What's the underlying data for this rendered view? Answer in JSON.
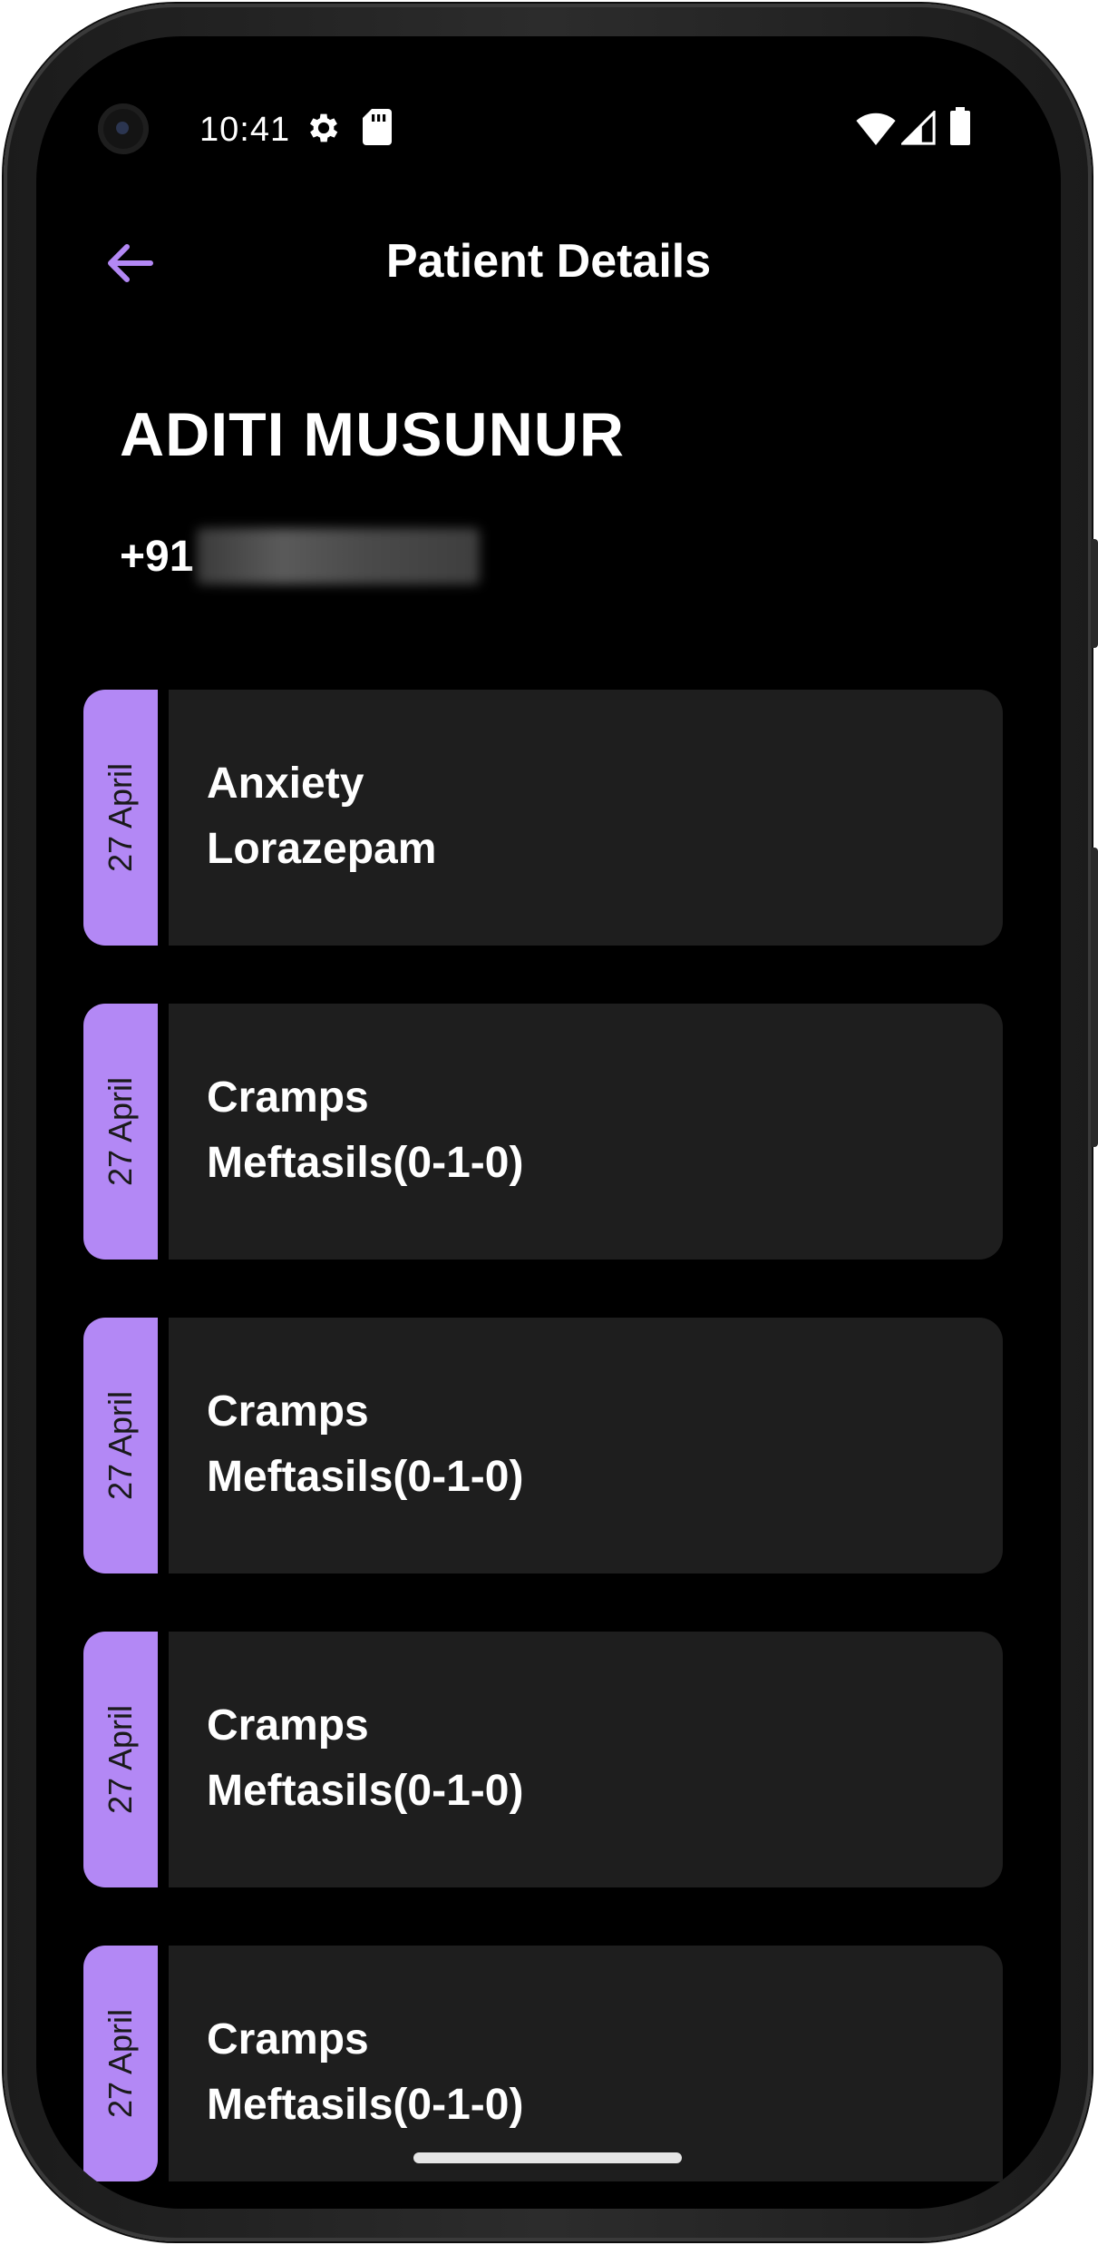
{
  "status_bar": {
    "time": "10:41",
    "icons": [
      "gear-icon",
      "sd-card-icon",
      "wifi-icon",
      "signal-icon",
      "battery-icon"
    ]
  },
  "app_bar": {
    "title": "Patient Details",
    "back_icon": "arrow-left-icon"
  },
  "patient": {
    "name": "ADITI MUSUNUR",
    "phone_prefix": "+91"
  },
  "colors": {
    "accent": "#b388f5",
    "background": "#000000",
    "card": "#1e1e1e"
  },
  "records": [
    {
      "date": "27 April",
      "condition": "Anxiety",
      "medicine": "Lorazepam"
    },
    {
      "date": "27 April",
      "condition": "Cramps",
      "medicine": "Meftasils(0-1-0)"
    },
    {
      "date": "27 April",
      "condition": "Cramps",
      "medicine": "Meftasils(0-1-0)"
    },
    {
      "date": "27 April",
      "condition": "Cramps",
      "medicine": "Meftasils(0-1-0)"
    },
    {
      "date": "27 April",
      "condition": "Cramps",
      "medicine": "Meftasils(0-1-0)"
    }
  ]
}
